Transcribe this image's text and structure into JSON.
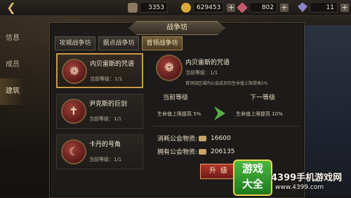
{
  "topbar": {
    "back_icon": "back-arrow-icon",
    "resources": [
      {
        "icon": "stone-icon",
        "value": "3353",
        "color": "#8a7a60",
        "has_plus": false
      },
      {
        "icon": "gold-coin-icon",
        "value": "629453",
        "color": "#d8a83a",
        "has_plus": true
      },
      {
        "icon": "ruby-icon",
        "value": "802",
        "color": "#c45a6a",
        "has_plus": true
      },
      {
        "icon": "diamond-icon",
        "value": "11",
        "color": "#8a86c8",
        "has_plus": true
      }
    ]
  },
  "sidenav": [
    "信息",
    "成员",
    "建筑"
  ],
  "panel": {
    "title": "战争坊",
    "tabs": [
      "攻城战争坊",
      "据点战争坊",
      "首领战争坊"
    ],
    "active_tab": 2
  },
  "buildings": [
    {
      "name": "内贝雷斯的咒语",
      "level": "当前等级：1/1",
      "icon": "spell-emblem-icon"
    },
    {
      "name": "尹克斯的巨剑",
      "level": "当前等级：1/1",
      "icon": "sword-emblem-icon"
    },
    {
      "name": "卡丹的号角",
      "level": "当前等级：1/1",
      "icon": "horn-emblem-icon"
    }
  ],
  "detail": {
    "name": "内贝雷斯的咒语",
    "level": "当前等级：1/1",
    "description": "首领战区域内公会成员的生命值上限提高5%",
    "current_label": "当前等级",
    "next_label": "下一等级",
    "current_effect": "生命值上限提高 5%",
    "next_effect": "生命值上限提高 10%",
    "cost_label": "消耗公会物资:",
    "cost_value": "16600",
    "owned_label": "拥有公会物资:",
    "owned_value": "206135",
    "upgrade_label": "升级"
  },
  "watermark": {
    "logo_line1": "游戏",
    "logo_line2": "大全",
    "title": "4399手机游戏网",
    "url": "www.4399.com"
  }
}
